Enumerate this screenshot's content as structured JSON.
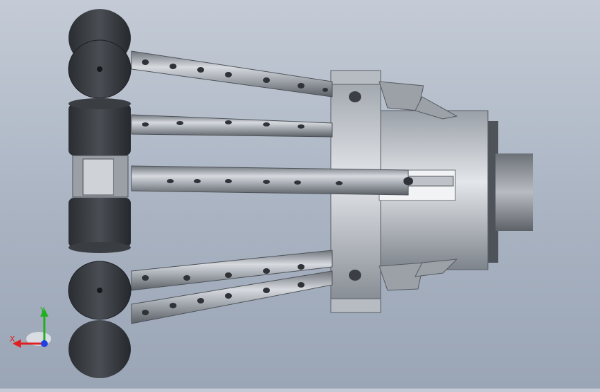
{
  "viewport": {
    "background_top": "#c4cbd6",
    "background_bottom": "#9aa5b6"
  },
  "model": {
    "metal_light": "#c9cdd3",
    "metal_mid": "#8c9198",
    "metal_dark": "#3e4248",
    "wheel_color": "#2e3136"
  },
  "triad": {
    "x_label": "X",
    "y_label": "Y",
    "x_color": "#e02020",
    "y_color": "#20b020",
    "z_color": "#2040e0"
  }
}
